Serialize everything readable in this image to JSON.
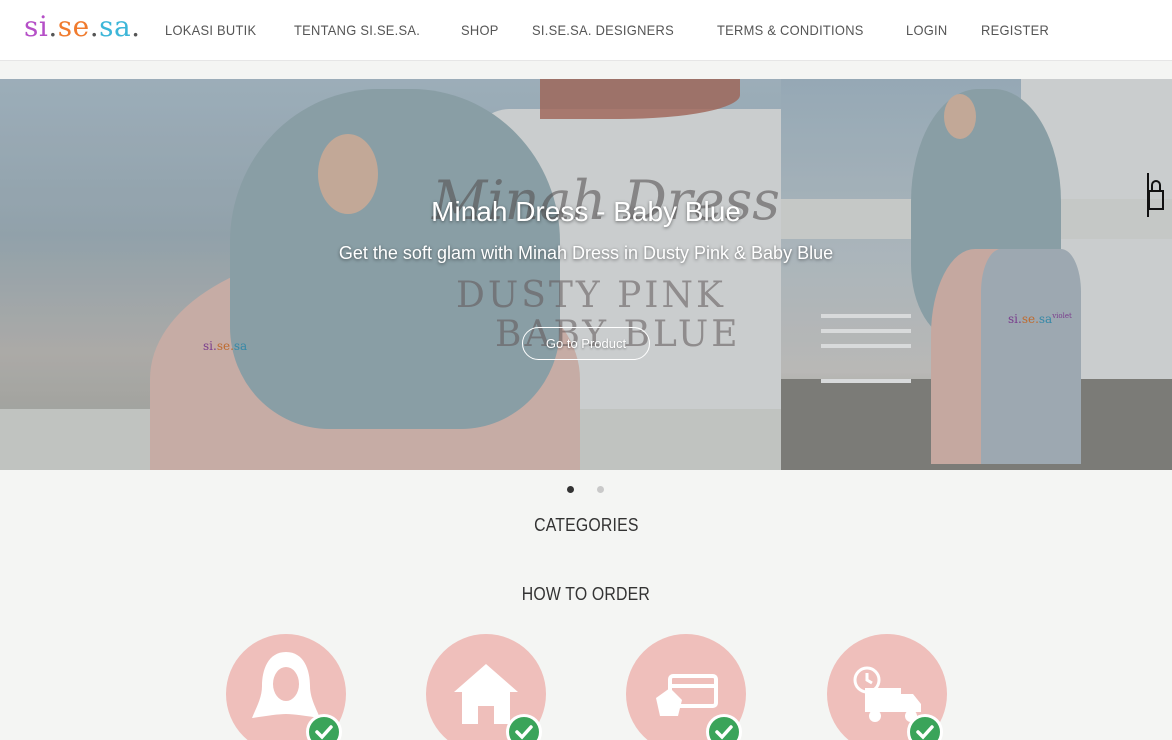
{
  "header": {
    "logo": {
      "part1": "si",
      "part2": "se",
      "part3": "sa",
      "dot": "."
    },
    "nav": [
      {
        "label": "LOKASI BUTIK"
      },
      {
        "label": "TENTANG SI.SE.SA."
      },
      {
        "label": "SHOP"
      },
      {
        "label": "SI.SE.SA. DESIGNERS"
      },
      {
        "label": "TERMS & CONDITIONS"
      },
      {
        "label": "LOGIN"
      },
      {
        "label": "REGISTER"
      }
    ]
  },
  "slider": {
    "title": "Minah Dress - Baby Blue",
    "subtitle": "Get the soft glam with Minah Dress in Dusty Pink & Baby Blue",
    "button_label": "Go to Product",
    "ghost_title": "Minah Dress",
    "ghost_line1": "DUSTY PINK",
    "ghost_line2": "BABY BLUE",
    "watermark_left": {
      "a": "si.",
      "b": "se.",
      "c": "sa"
    },
    "watermark_right": {
      "a": "si.",
      "b": "se.",
      "c": "sa",
      "d": "violet"
    },
    "active_slide": 1,
    "slide_count": 2
  },
  "sections": {
    "categories_title": "CATEGORIES",
    "how_to_order_title": "HOW TO ORDER"
  },
  "steps": [
    {
      "icon": "hijab-person-icon"
    },
    {
      "icon": "house-icon"
    },
    {
      "icon": "card-payment-icon"
    },
    {
      "icon": "delivery-truck-icon"
    }
  ],
  "colors": {
    "logo_si": "#b54fc7",
    "logo_se": "#f07b2e",
    "logo_sa": "#3cb6d8",
    "step_circle": "#efbfbb",
    "check_green": "#3aa45a"
  }
}
